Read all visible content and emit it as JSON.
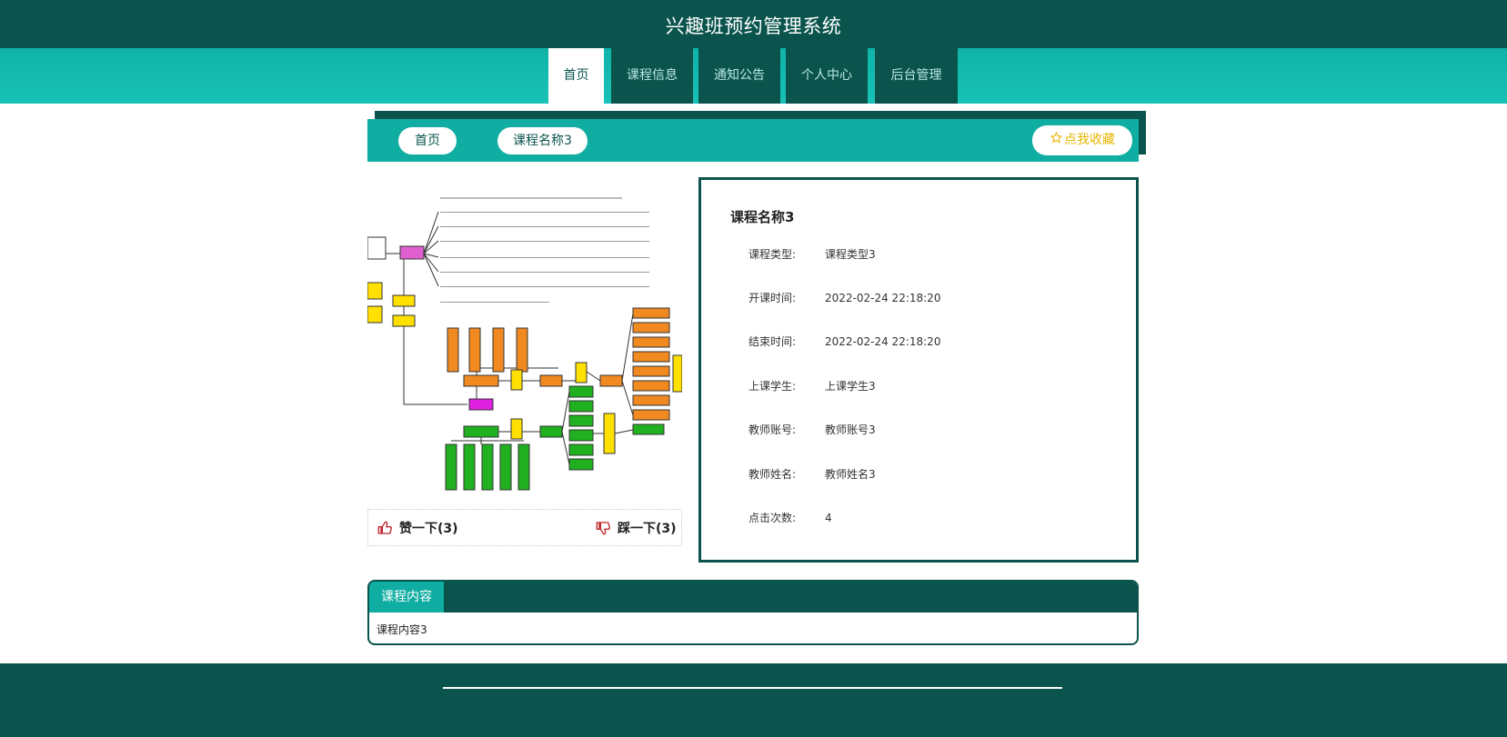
{
  "header": {
    "title": "兴趣班预约管理系统"
  },
  "nav": [
    {
      "label": "首页",
      "active": true
    },
    {
      "label": "课程信息",
      "active": false
    },
    {
      "label": "通知公告",
      "active": false
    },
    {
      "label": "个人中心",
      "active": false
    },
    {
      "label": "后台管理",
      "active": false
    }
  ],
  "breadcrumb": {
    "home": "首页",
    "current": "课程名称3"
  },
  "favorite": {
    "label": "点我收藏"
  },
  "votes": {
    "like_label": "赞一下(3)",
    "dislike_label": "踩一下(3)"
  },
  "detail": {
    "title": "课程名称3",
    "fields": [
      {
        "label": "课程类型:",
        "value": "课程类型3"
      },
      {
        "label": "开课时间:",
        "value": "2022-02-24 22:18:20"
      },
      {
        "label": "结束时间:",
        "value": "2022-02-24 22:18:20"
      },
      {
        "label": "上课学生:",
        "value": "上课学生3"
      },
      {
        "label": "教师账号:",
        "value": "教师账号3"
      },
      {
        "label": "教师姓名:",
        "value": "教师姓名3"
      },
      {
        "label": "点击次数:",
        "value": "4"
      }
    ]
  },
  "content": {
    "tab_label": "课程内容",
    "body": "课程内容3"
  },
  "colors": {
    "dark_teal": "#0b544d",
    "teal": "#0fada2",
    "accent_yellow": "#e8b600",
    "vote_red": "#c0262b"
  }
}
